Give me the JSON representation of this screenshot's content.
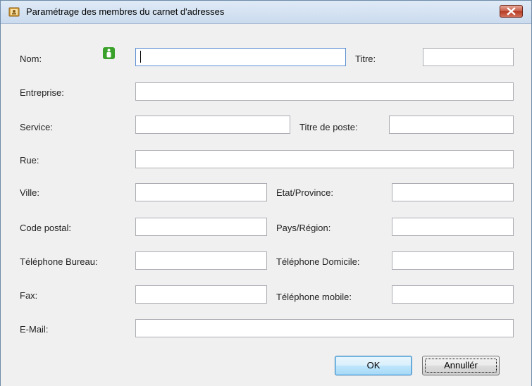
{
  "window": {
    "title": "Paramétrage des membres du carnet d'adresses",
    "icon": "address-book-icon",
    "close_icon": "close-icon"
  },
  "form": {
    "nom_label": "Nom:",
    "titre_label": "Titre:",
    "entreprise_label": "Entreprise:",
    "service_label": "Service:",
    "titre_poste_label": "Titre de poste:",
    "rue_label": "Rue:",
    "ville_label": "Ville:",
    "etat_label": "Etat/Province:",
    "code_postal_label": "Code postal:",
    "pays_label": "Pays/Région:",
    "tel_bureau_label": "Téléphone Bureau:",
    "tel_domicile_label": "Téléphone Domicile:",
    "fax_label": "Fax:",
    "tel_mobile_label": "Téléphone mobile:",
    "email_label": "E-Mail:",
    "values": {
      "nom": "",
      "titre": "",
      "entreprise": "",
      "service": "",
      "titre_poste": "",
      "rue": "",
      "ville": "",
      "etat": "",
      "code_postal": "",
      "pays": "",
      "tel_bureau": "",
      "tel_domicile": "",
      "fax": "",
      "tel_mobile": "",
      "email": ""
    },
    "person_icon": "person-icon"
  },
  "buttons": {
    "ok": "OK",
    "cancel": "Annullér"
  },
  "colors": {
    "title_bar": "#cbdbee",
    "close_button": "#c75a43",
    "person_icon": "#3aa12b",
    "focus_border": "#5a8ed2"
  }
}
